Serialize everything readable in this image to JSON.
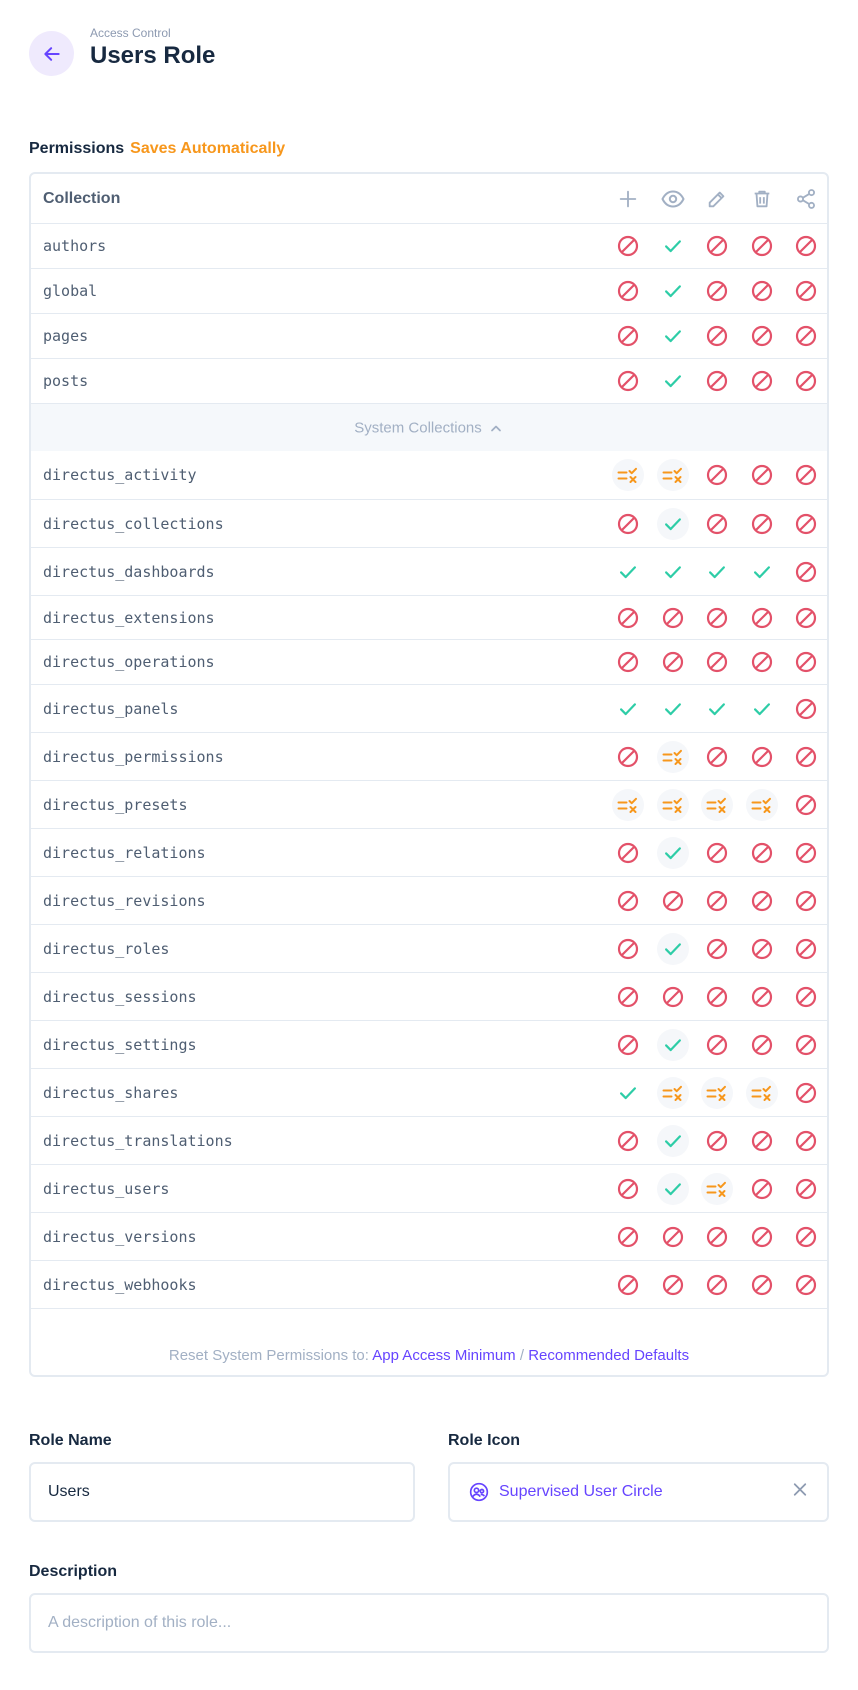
{
  "header": {
    "breadcrumb": "Access Control",
    "title": "Users Role"
  },
  "permissions": {
    "label": "Permissions",
    "saves_label": "Saves Automatically",
    "column_header": "Collection",
    "action_icons": [
      "create-icon",
      "read-icon",
      "update-icon",
      "delete-icon",
      "share-icon"
    ],
    "collections": [
      {
        "name": "authors",
        "perms": [
          "none",
          "all",
          "none",
          "none",
          "none"
        ]
      },
      {
        "name": "global",
        "perms": [
          "none",
          "all",
          "none",
          "none",
          "none"
        ]
      },
      {
        "name": "pages",
        "perms": [
          "none",
          "all",
          "none",
          "none",
          "none"
        ]
      },
      {
        "name": "posts",
        "perms": [
          "none",
          "all",
          "none",
          "none",
          "none"
        ]
      }
    ],
    "system_toggle_label": "System Collections",
    "system_collections": [
      {
        "name": "directus_activity",
        "perms": [
          "custom",
          "custom",
          "none",
          "none",
          "none"
        ]
      },
      {
        "name": "directus_collections",
        "perms": [
          "none",
          "all",
          "none",
          "none",
          "none"
        ]
      },
      {
        "name": "directus_dashboards",
        "perms": [
          "all",
          "all",
          "all",
          "all",
          "none"
        ]
      },
      {
        "name": "directus_extensions",
        "perms": [
          "none",
          "none",
          "none",
          "none",
          "none"
        ]
      },
      {
        "name": "directus_operations",
        "perms": [
          "none",
          "none",
          "none",
          "none",
          "none"
        ]
      },
      {
        "name": "directus_panels",
        "perms": [
          "all",
          "all",
          "all",
          "all",
          "none"
        ]
      },
      {
        "name": "directus_permissions",
        "perms": [
          "none",
          "custom",
          "none",
          "none",
          "none"
        ]
      },
      {
        "name": "directus_presets",
        "perms": [
          "custom",
          "custom",
          "custom",
          "custom",
          "none"
        ]
      },
      {
        "name": "directus_relations",
        "perms": [
          "none",
          "all",
          "none",
          "none",
          "none"
        ]
      },
      {
        "name": "directus_revisions",
        "perms": [
          "none",
          "none",
          "none",
          "none",
          "none"
        ]
      },
      {
        "name": "directus_roles",
        "perms": [
          "none",
          "all",
          "none",
          "none",
          "none"
        ]
      },
      {
        "name": "directus_sessions",
        "perms": [
          "none",
          "none",
          "none",
          "none",
          "none"
        ]
      },
      {
        "name": "directus_settings",
        "perms": [
          "none",
          "all",
          "none",
          "none",
          "none"
        ]
      },
      {
        "name": "directus_shares",
        "perms": [
          "all",
          "custom",
          "custom",
          "custom",
          "none"
        ]
      },
      {
        "name": "directus_translations",
        "perms": [
          "none",
          "all",
          "none",
          "none",
          "none"
        ]
      },
      {
        "name": "directus_users",
        "perms": [
          "none",
          "all",
          "custom",
          "none",
          "none"
        ]
      },
      {
        "name": "directus_versions",
        "perms": [
          "none",
          "none",
          "none",
          "none",
          "none"
        ]
      },
      {
        "name": "directus_webhooks",
        "perms": [
          "none",
          "none",
          "none",
          "none",
          "none"
        ]
      }
    ],
    "reset_label": "Reset System Permissions to:",
    "reset_option_1": "App Access Minimum",
    "reset_separator": "/",
    "reset_option_2": "Recommended Defaults"
  },
  "form": {
    "role_name_label": "Role Name",
    "role_name_value": "Users",
    "role_icon_label": "Role Icon",
    "role_icon_value": "Supervised User Circle",
    "description_label": "Description",
    "description_placeholder": "A description of this role..."
  },
  "colors": {
    "accent": "#6644ff",
    "warning": "#f7971c",
    "success": "#2ecda7",
    "danger": "#e35169"
  }
}
